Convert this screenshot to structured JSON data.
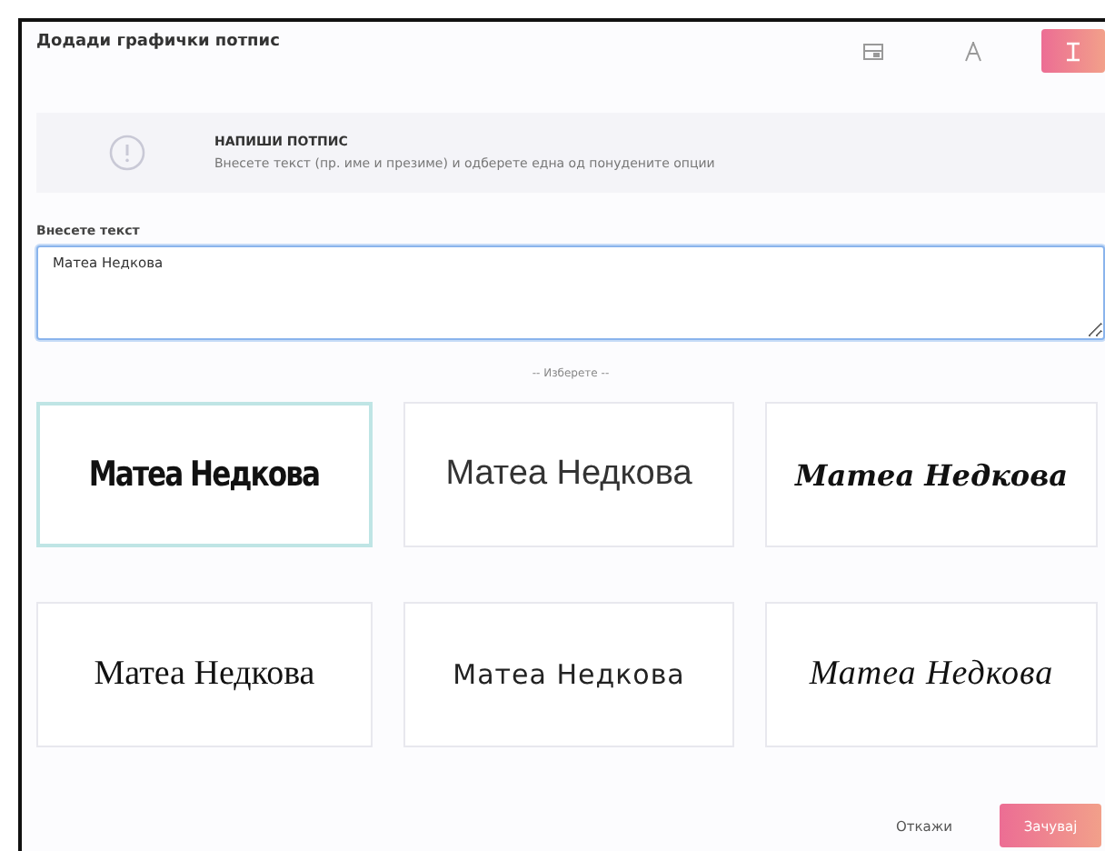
{
  "dialog": {
    "title": "Додади графички потпис"
  },
  "modes": [
    {
      "kind": "image",
      "selected": false
    },
    {
      "kind": "draw",
      "selected": false
    },
    {
      "kind": "type",
      "selected": true
    }
  ],
  "notice": {
    "heading": "НАПИШИ ПОТПИС",
    "text": "Внесете текст (пр. име и презиме) и одберете една од понудените опции"
  },
  "text_field": {
    "label": "Внесете текст",
    "value": "Матеа Недкова"
  },
  "choose_label": "-- Изберете --",
  "styles": [
    {
      "kind": "condensed",
      "text": "Матеа Недкова",
      "selected": true
    },
    {
      "kind": "light",
      "text": "Матеа Недкова",
      "selected": false
    },
    {
      "kind": "brush",
      "text": "Матеа Недкова",
      "selected": false
    },
    {
      "kind": "serif",
      "text": "Матеа Недкова",
      "selected": false
    },
    {
      "kind": "rounded",
      "text": "Матеа Недкова",
      "selected": false
    },
    {
      "kind": "script",
      "text": "Матеа Недкова",
      "selected": false
    }
  ],
  "buttons": [
    {
      "kind": "cancel",
      "label": "Откажи"
    },
    {
      "kind": "save",
      "label": "Зачувај"
    }
  ]
}
